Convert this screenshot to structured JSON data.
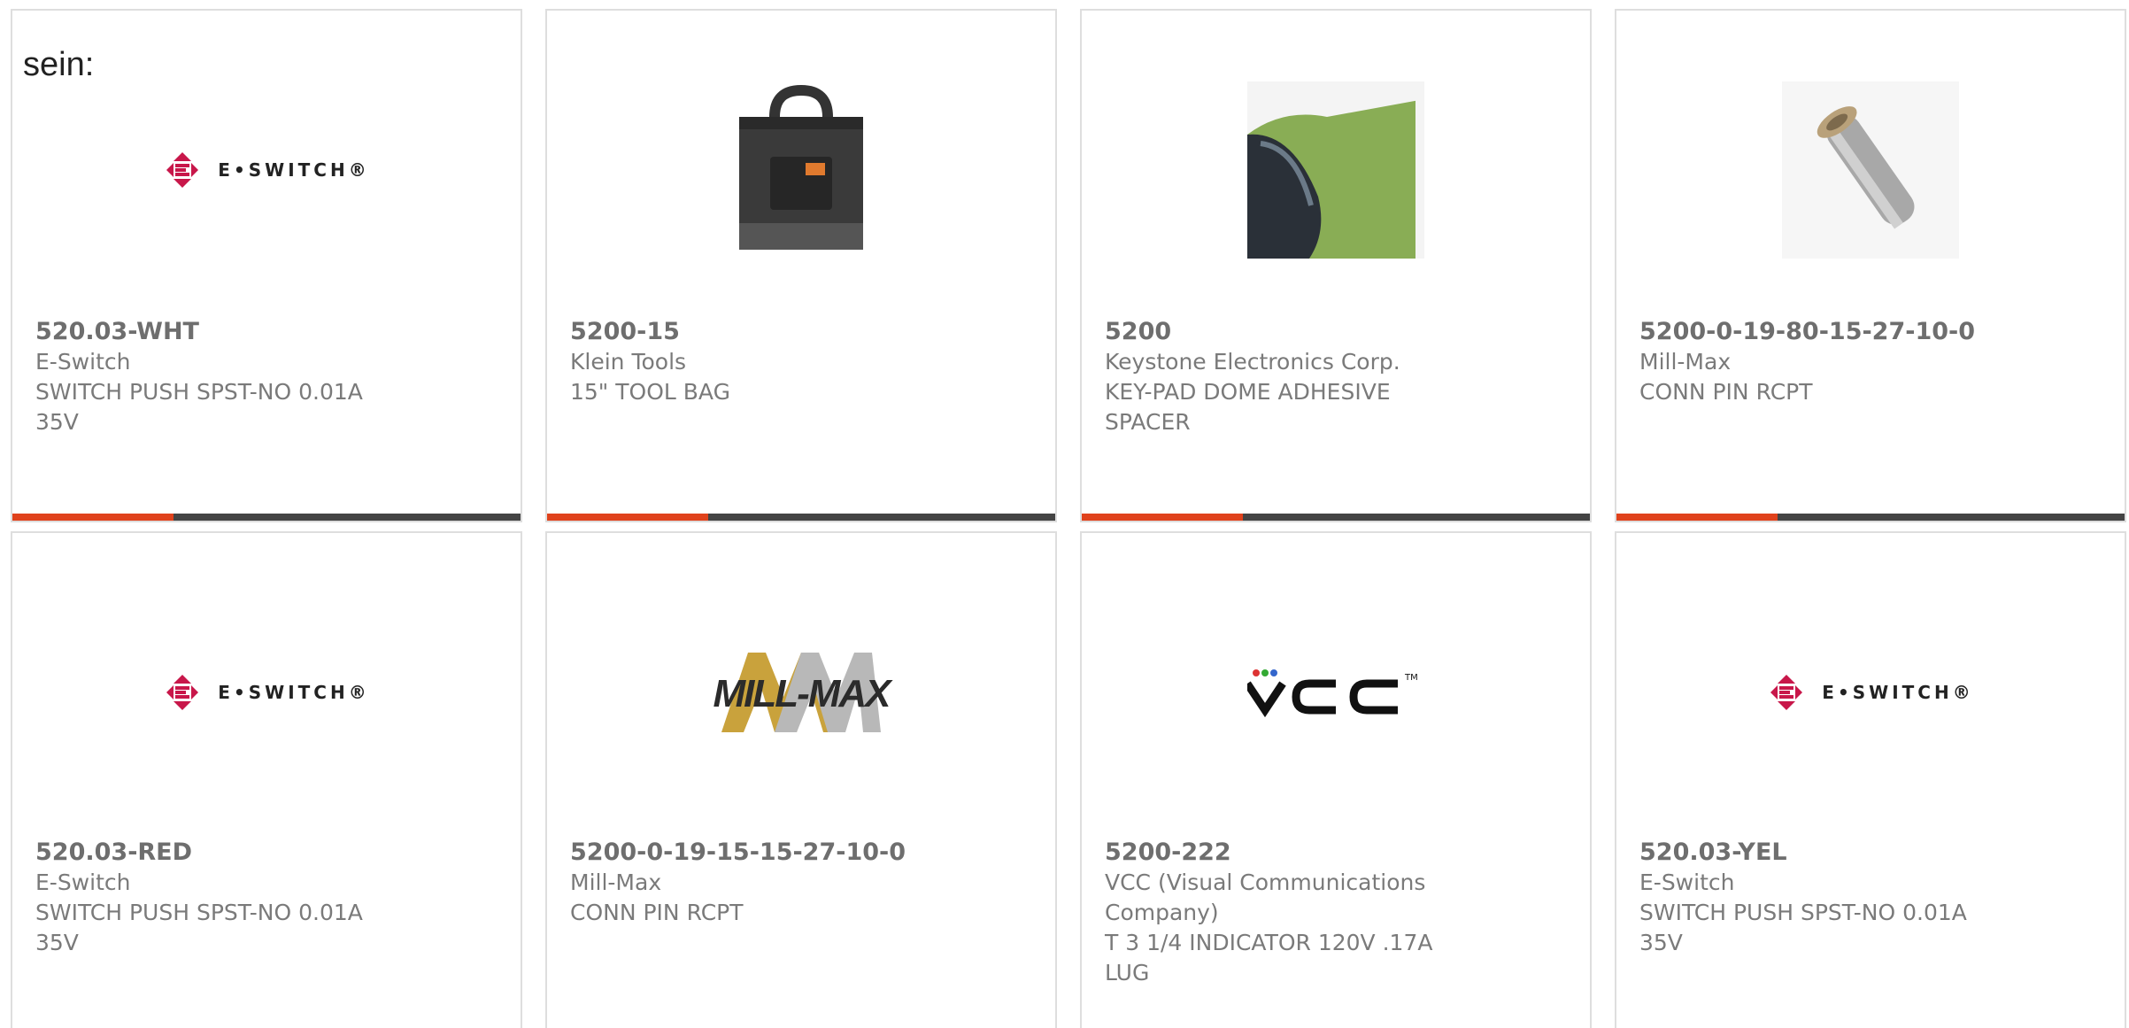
{
  "intro_label": "sein:",
  "colors": {
    "accent": "#e0421c",
    "bar": "#444444",
    "border": "#dedede",
    "text": "#7a7a7a",
    "eswitch_red": "#c8174a"
  },
  "cards": [
    {
      "part_number": "520.03-WHT",
      "manufacturer": "E-Switch",
      "description": "SWITCH PUSH SPST-NO 0.01A 35V",
      "image": "eswitch-logo",
      "logo_text": "E•SWITCH®"
    },
    {
      "part_number": "5200-15",
      "manufacturer": "Klein Tools",
      "description": "15\" TOOL BAG",
      "image": "tool-bag-photo"
    },
    {
      "part_number": "5200",
      "manufacturer": "Keystone Electronics Corp.",
      "description": "KEY-PAD DOME ADHESIVE SPACER",
      "image": "adhesive-spacer-photo"
    },
    {
      "part_number": "5200-0-19-80-15-27-10-0",
      "manufacturer": "Mill-Max",
      "description": "CONN PIN RCPT",
      "image": "pin-receptacle-photo"
    },
    {
      "part_number": "520.03-RED",
      "manufacturer": "E-Switch",
      "description": "SWITCH PUSH SPST-NO 0.01A 35V",
      "image": "eswitch-logo",
      "logo_text": "E•SWITCH®"
    },
    {
      "part_number": "5200-0-19-15-15-27-10-0",
      "manufacturer": "Mill-Max",
      "description": "CONN PIN RCPT",
      "image": "millmax-logo",
      "logo_text": "MILL-MAX"
    },
    {
      "part_number": "5200-222",
      "manufacturer": "VCC (Visual Communications Company)",
      "description": "T 3 1/4 INDICATOR 120V .17A LUG",
      "image": "vcc-logo",
      "logo_text": "VCC"
    },
    {
      "part_number": "520.03-YEL",
      "manufacturer": "E-Switch",
      "description": "SWITCH PUSH SPST-NO 0.01A 35V",
      "image": "eswitch-logo",
      "logo_text": "E•SWITCH®"
    }
  ]
}
